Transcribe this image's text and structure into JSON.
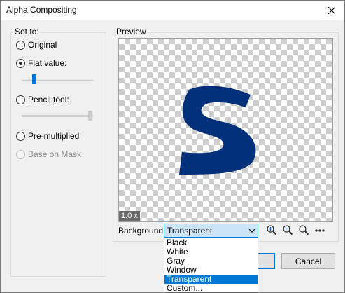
{
  "window": {
    "title": "Alpha Compositing"
  },
  "set_to": {
    "label": "Set to:",
    "options": [
      {
        "label": "Original",
        "checked": false,
        "disabled": false
      },
      {
        "label": "Flat value:",
        "checked": true,
        "disabled": false
      },
      {
        "label": "Pencil tool:",
        "checked": false,
        "disabled": false
      },
      {
        "label": "Pre-multiplied",
        "checked": false,
        "disabled": false
      },
      {
        "label": "Base on Mask",
        "checked": false,
        "disabled": true
      }
    ],
    "flat_value_level": 0.2,
    "pencil_tool_level": 1.0
  },
  "preview": {
    "label": "Preview",
    "zoom": "1.0 x",
    "glyph_color": "#02307a"
  },
  "background": {
    "label": "Background:",
    "selected": "Transparent",
    "options": [
      "Black",
      "White",
      "Gray",
      "Window",
      "Transparent",
      "Custom..."
    ],
    "selected_index": 4
  },
  "buttons": {
    "cancel": "Cancel"
  },
  "colors": {
    "accent": "#0078d7"
  }
}
